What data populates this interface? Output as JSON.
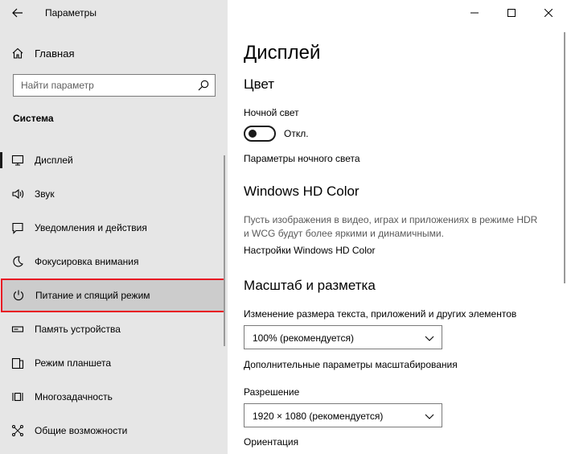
{
  "window": {
    "title": "Параметры",
    "controls": [
      "minimize",
      "maximize",
      "close"
    ]
  },
  "sidebar": {
    "home_label": "Главная",
    "search_placeholder": "Найти параметр",
    "section_title": "Система",
    "items": [
      {
        "label": "Дисплей",
        "icon": "monitor-icon"
      },
      {
        "label": "Звук",
        "icon": "speaker-icon"
      },
      {
        "label": "Уведомления и действия",
        "icon": "notification-icon"
      },
      {
        "label": "Фокусировка внимания",
        "icon": "moon-icon"
      },
      {
        "label": "Питание и спящий режим",
        "icon": "power-icon",
        "selected": true
      },
      {
        "label": "Память устройства",
        "icon": "storage-icon"
      },
      {
        "label": "Режим планшета",
        "icon": "tablet-icon"
      },
      {
        "label": "Многозадачность",
        "icon": "multitask-icon"
      },
      {
        "label": "Общие возможности",
        "icon": "share-icon"
      }
    ]
  },
  "main": {
    "title": "Дисплей",
    "color_section": {
      "heading": "Цвет",
      "night_light_label": "Ночной свет",
      "toggle_state": "Откл.",
      "night_light_settings_link": "Параметры ночного света"
    },
    "hdr_section": {
      "heading": "Windows HD Color",
      "description_line1": "Пусть изображения в видео, играх и приложениях в режиме HDR",
      "description_line2": "и WCG будут более яркими и динамичными.",
      "settings_link": "Настройки Windows HD Color"
    },
    "scale_section": {
      "heading": "Масштаб и разметка",
      "scale_label": "Изменение размера текста, приложений и других элементов",
      "scale_value": "100% (рекомендуется)",
      "advanced_scaling_link": "Дополнительные параметры масштабирования",
      "resolution_label": "Разрешение",
      "resolution_value": "1920 × 1080 (рекомендуется)",
      "orientation_label": "Ориентация"
    }
  },
  "colors": {
    "sidebar_bg": "#e6e6e6",
    "selected_bg": "#cccccc",
    "highlight_border": "#e81123"
  }
}
